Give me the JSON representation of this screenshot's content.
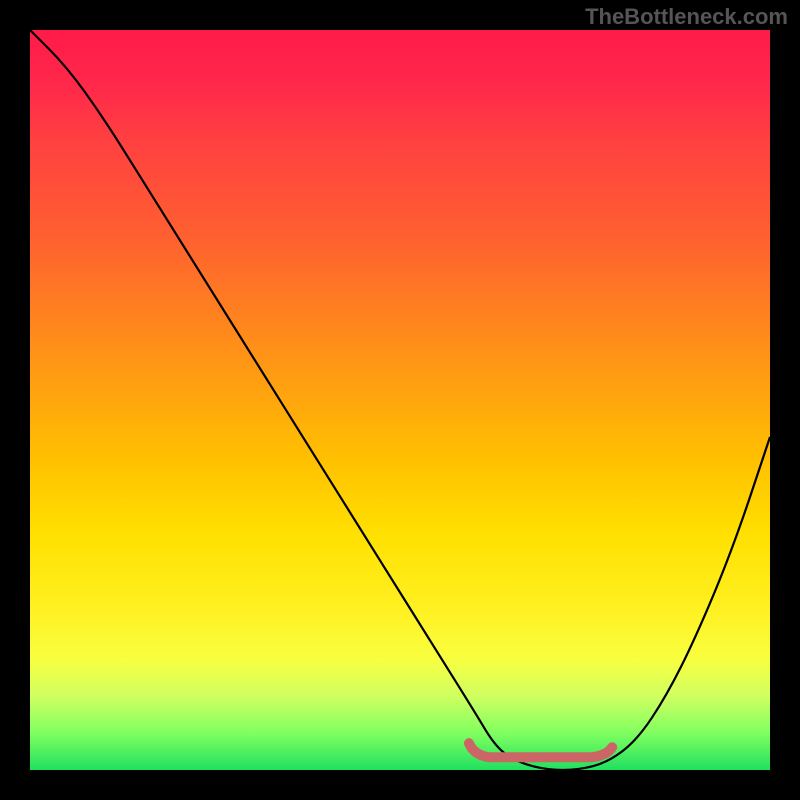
{
  "watermark": "TheBottleneck.com",
  "chart_data": {
    "type": "line",
    "title": "",
    "xlabel": "",
    "ylabel": "",
    "xlim": [
      0,
      100
    ],
    "ylim": [
      0,
      100
    ],
    "series": [
      {
        "name": "bottleneck-curve",
        "x": [
          0,
          5,
          10,
          15,
          20,
          25,
          30,
          35,
          40,
          45,
          50,
          55,
          60,
          63,
          66,
          70,
          74,
          78,
          82,
          86,
          90,
          95,
          100
        ],
        "values": [
          100,
          95,
          88,
          80,
          72,
          64,
          56,
          48,
          40,
          32,
          24,
          16,
          8,
          3,
          1,
          0,
          0,
          1,
          4,
          10,
          18,
          30,
          45
        ]
      }
    ],
    "marker": {
      "x_start": 60,
      "x_end": 78,
      "y": 2
    },
    "gradient_colors": {
      "top": "#ff1a4a",
      "middle": "#ffe000",
      "bottom": "#20e060"
    }
  }
}
